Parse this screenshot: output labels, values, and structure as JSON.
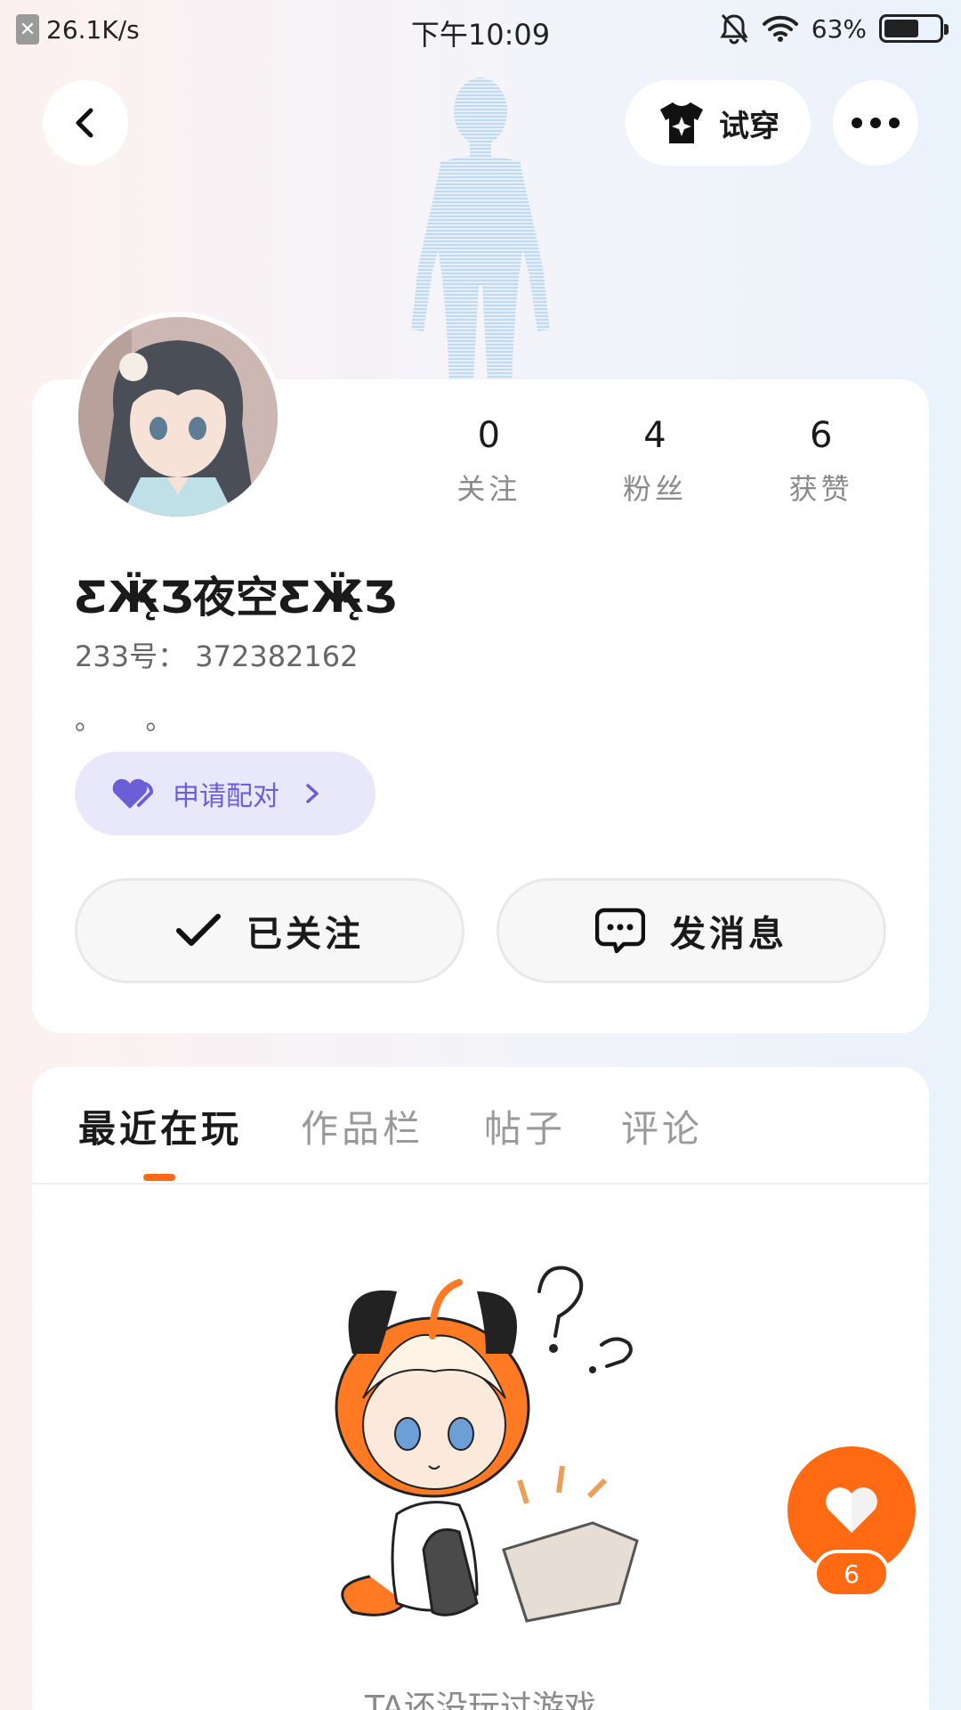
{
  "status_bar": {
    "net_speed": "26.1K/s",
    "time": "下午10:09",
    "battery": "63%",
    "battery_level": 0.63
  },
  "top_nav": {
    "try_on_label": "试穿"
  },
  "profile": {
    "stats": [
      {
        "value": "0",
        "label": "关注"
      },
      {
        "value": "4",
        "label": "粉丝"
      },
      {
        "value": "6",
        "label": "获赞"
      }
    ],
    "username": "ƸӜ̵̨̄Ʒ夜空ƸӜ̵̨̄Ʒ",
    "user_id": "233号：  372382162",
    "bio": "。 。",
    "pair_label": "申请配对",
    "follow_label": "已关注",
    "message_label": "发消息"
  },
  "tabs": [
    "最近在玩",
    "作品栏",
    "帖子",
    "评论"
  ],
  "empty_state": {
    "text": "TA还没玩过游戏"
  },
  "like": {
    "count": "6"
  },
  "colors": {
    "accent": "#ff6a12",
    "pair_bg": "#e9e8fb",
    "pair_fg": "#6b5fd8"
  }
}
